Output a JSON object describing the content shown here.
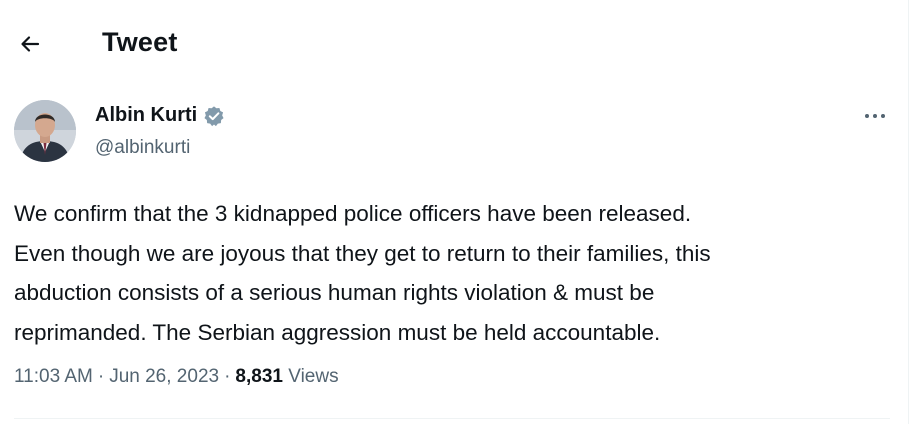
{
  "header": {
    "title": "Tweet"
  },
  "author": {
    "name": "Albin Kurti",
    "handle": "@albinkurti",
    "verified": true
  },
  "tweet": {
    "lines": [
      "We confirm that the 3 kidnapped police officers have been released.",
      "Even though we are joyous that they get to return to their families, this",
      "abduction consists of a serious human rights violation & must be",
      "reprimanded. The Serbian aggression must be held accountable."
    ]
  },
  "meta": {
    "time": "11:03 AM",
    "separator1": "·",
    "date": "Jun 26, 2023",
    "separator2": "·",
    "views_count": "8,831",
    "views_label": "Views"
  },
  "icons": {
    "back": "arrow-left-icon",
    "verified": "verified-badge-icon",
    "more": "more-horizontal-icon"
  },
  "colors": {
    "text_primary": "#0f1419",
    "text_secondary": "#536471",
    "verified_badge": "#829aab"
  }
}
